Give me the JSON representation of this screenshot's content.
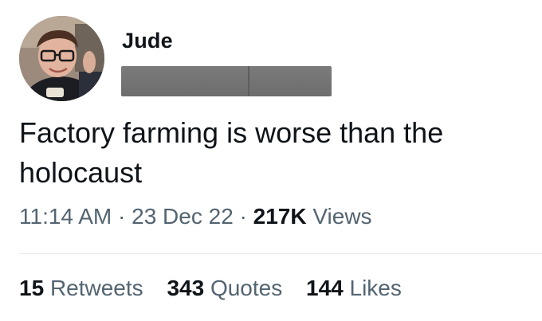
{
  "author": {
    "name": "Jude",
    "handle_redacted": true
  },
  "tweet": {
    "text_line1": "Factory farming is worse than the",
    "text_line2": "holocaust"
  },
  "meta": {
    "time": "11:14 AM",
    "sep1": "·",
    "date": "23 Dec 22",
    "sep2": "·",
    "views_count": "217K",
    "views_label": "Views"
  },
  "stats": {
    "retweets_count": "15",
    "retweets_label": "Retweets",
    "quotes_count": "343",
    "quotes_label": "Quotes",
    "likes_count": "144",
    "likes_label": "Likes"
  },
  "colors": {
    "text_primary": "#0f1419",
    "text_secondary": "#536471",
    "divider": "#e6e9eb",
    "redaction": "#727272"
  }
}
